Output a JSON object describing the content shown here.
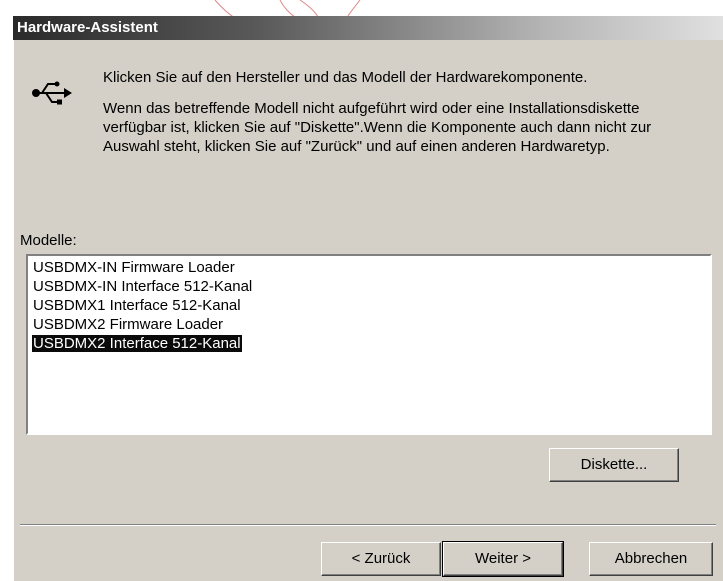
{
  "window": {
    "title": "Hardware-Assistent"
  },
  "intro": {
    "line1": "Klicken Sie auf den Hersteller und das Modell der Hardwarekomponente.",
    "line2": "Wenn das betreffende Modell nicht aufgeführt wird oder eine Installationsdiskette verfügbar ist, klicken Sie auf \"Diskette\".Wenn die Komponente auch dann nicht zur Auswahl steht, klicken Sie auf \"Zurück\" und auf einen anderen Hardwaretyp."
  },
  "models": {
    "label": "Modelle:",
    "items": [
      {
        "label": "USBDMX-IN Firmware Loader",
        "selected": false
      },
      {
        "label": "USBDMX-IN Interface 512-Kanal",
        "selected": false
      },
      {
        "label": "USBDMX1 Interface 512-Kanal",
        "selected": false
      },
      {
        "label": "USBDMX2 Firmware Loader",
        "selected": false
      },
      {
        "label": "USBDMX2 Interface 512-Kanal",
        "selected": true
      }
    ]
  },
  "buttons": {
    "diskette": "Diskette...",
    "back": "< Zurück",
    "next": "Weiter >",
    "cancel": "Abbrechen"
  },
  "icons": {
    "usb": "usb-icon"
  }
}
